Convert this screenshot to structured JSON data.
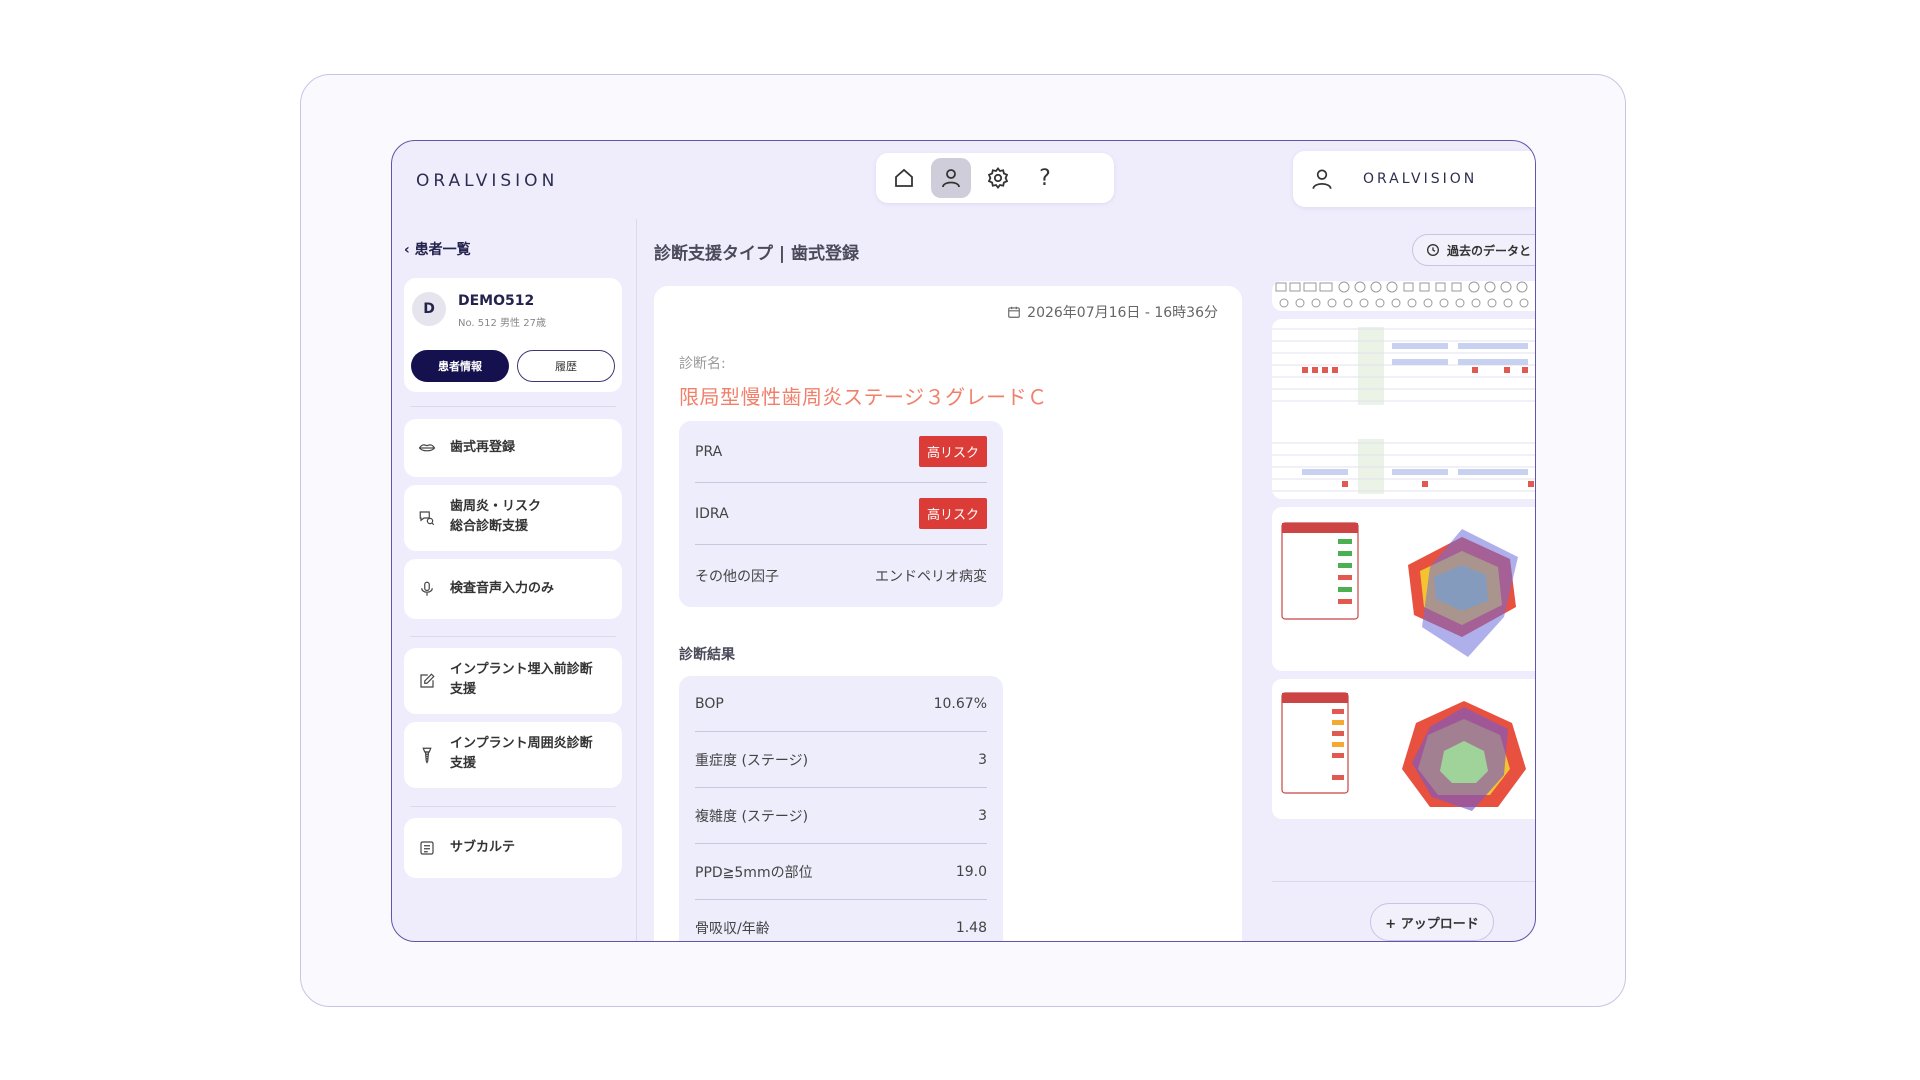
{
  "header": {
    "logo": "ORALVISION",
    "account_logo": "ORALVISION",
    "nav": [
      {
        "icon": "home-icon",
        "active": false
      },
      {
        "icon": "user-icon",
        "active": true
      },
      {
        "icon": "gear-icon",
        "active": false
      },
      {
        "icon": "help-icon",
        "label": "?",
        "active": false
      }
    ]
  },
  "sidebar": {
    "back_label": "患者一覧",
    "patient": {
      "initial": "D",
      "name": "DEMO512",
      "meta": "No. 512  男性  27歳",
      "info_button": "患者情報",
      "history_button": "履歴"
    },
    "items": [
      {
        "icon": "lips-icon",
        "label": "歯式再登録"
      },
      {
        "icon": "chat-search-icon",
        "label_line1": "歯周炎・リスク",
        "label_line2": "総合診断支援"
      },
      {
        "icon": "mic-icon",
        "label": "検査音声入力のみ"
      },
      {
        "icon": "edit-icon",
        "label_line1": "インプラント埋入前診断",
        "label_line2": "支援"
      },
      {
        "icon": "implant-icon",
        "label_line1": "インプラント周囲炎診断",
        "label_line2": "支援"
      },
      {
        "icon": "document-icon",
        "label": "サブカルテ"
      }
    ]
  },
  "main": {
    "title": "診断支援タイプ | 歯式登録",
    "history_button": "過去のデータと",
    "date": "2026年07月16日 - 16時36分",
    "diagnosis_label": "診断名:",
    "diagnosis_name": "限局型慢性歯周炎ステージ３グレードＣ",
    "risk_rows": [
      {
        "label": "PRA",
        "value": "高リスク"
      },
      {
        "label": "IDRA",
        "value": "高リスク"
      },
      {
        "label": "その他の因子",
        "value": "エンドペリオ病変"
      }
    ],
    "results_label": "診断結果",
    "result_rows": [
      {
        "label": "BOP",
        "value": "10.67%"
      },
      {
        "label": "重症度 (ステージ)",
        "value": "3"
      },
      {
        "label": "複雑度 (ステージ)",
        "value": "3"
      },
      {
        "label": "PPD≧5mmの部位",
        "value": "19.0"
      },
      {
        "label": "骨吸収/年齢",
        "value": "1.48"
      }
    ]
  },
  "right": {
    "upload_button": "+ アップロード"
  },
  "colors": {
    "accent": "#15114f",
    "risk": "#dc3c37",
    "diagnosis": "#f27f6a",
    "background": "#efedfc"
  }
}
